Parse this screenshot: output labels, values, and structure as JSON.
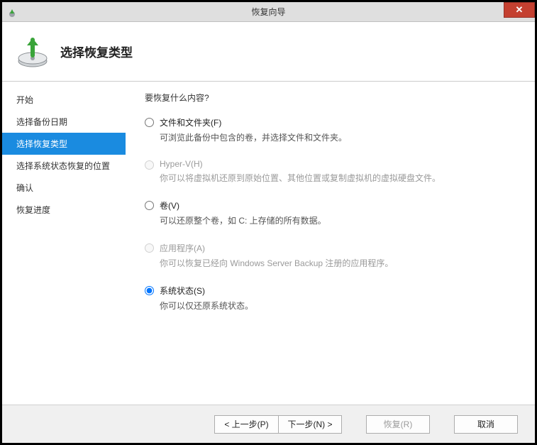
{
  "window": {
    "title": "恢复向导"
  },
  "header": {
    "title": "选择恢复类型"
  },
  "sidebar": {
    "steps": [
      {
        "label": "开始",
        "active": false
      },
      {
        "label": "选择备份日期",
        "active": false
      },
      {
        "label": "选择恢复类型",
        "active": true
      },
      {
        "label": "选择系统状态恢复的位置",
        "active": false
      },
      {
        "label": "确认",
        "active": false
      },
      {
        "label": "恢复进度",
        "active": false
      }
    ]
  },
  "content": {
    "question": "要恢复什么内容?",
    "options": [
      {
        "id": "files",
        "label": "文件和文件夹(F)",
        "desc": "可浏览此备份中包含的卷，并选择文件和文件夹。",
        "enabled": true,
        "selected": false
      },
      {
        "id": "hyperv",
        "label": "Hyper-V(H)",
        "desc": "你可以将虚拟机还原到原始位置、其他位置或复制虚拟机的虚拟硬盘文件。",
        "enabled": false,
        "selected": false
      },
      {
        "id": "volume",
        "label": "卷(V)",
        "desc": "可以还原整个卷，如 C: 上存储的所有数据。",
        "enabled": true,
        "selected": false
      },
      {
        "id": "apps",
        "label": "应用程序(A)",
        "desc": "你可以恢复已经向 Windows Server Backup 注册的应用程序。",
        "enabled": false,
        "selected": false
      },
      {
        "id": "system",
        "label": "系统状态(S)",
        "desc": "你可以仅还原系统状态。",
        "enabled": true,
        "selected": true
      }
    ]
  },
  "footer": {
    "back": "< 上一步(P)",
    "next": "下一步(N) >",
    "recover": "恢复(R)",
    "cancel": "取消"
  }
}
